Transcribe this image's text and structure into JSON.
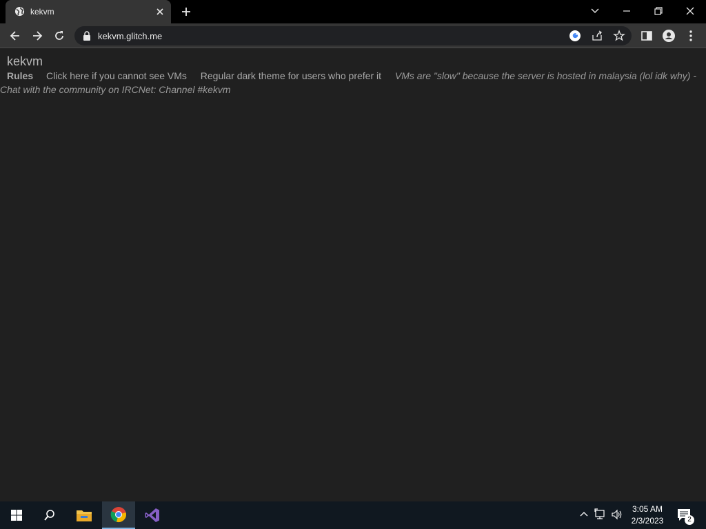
{
  "browser": {
    "tab": {
      "title": "kekvm",
      "favicon": "globe-icon"
    },
    "url": "kekvm.glitch.me"
  },
  "page": {
    "title": "kekvm",
    "nav": {
      "rules": "Rules",
      "cannot_see": "Click here if you cannot see VMs",
      "dark_theme": "Regular dark theme for users who prefer it",
      "notice": "VMs are \"slow\" because the server is hosted in malaysia (lol idk why) - Chat with the community on IRCNet: Channel #kekvm"
    }
  },
  "taskbar": {
    "time": "3:05 AM",
    "date": "2/3/2023",
    "notification_count": "2",
    "apps": [
      "start-icon",
      "search-icon",
      "file-explorer-icon",
      "chrome-icon",
      "visual-studio-icon"
    ]
  },
  "colors": {
    "page_bg": "#202020",
    "toolbar_bg": "#353535",
    "taskbar_bg": "#101820",
    "accent": "#7fb3e0"
  }
}
